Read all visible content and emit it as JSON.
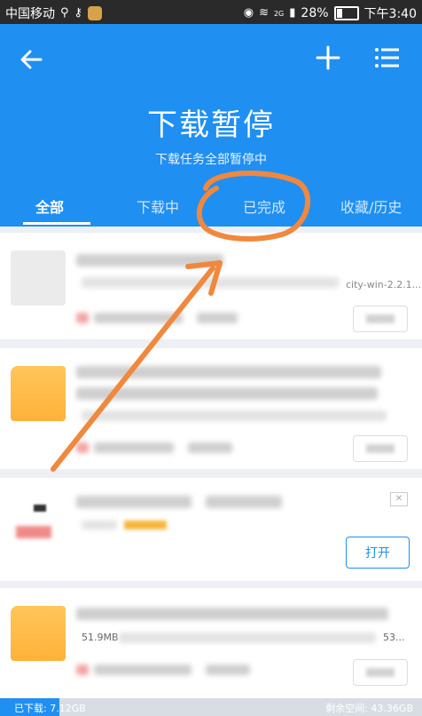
{
  "status_bar": {
    "carrier": "中国移动",
    "signal_badge": "2G",
    "battery_percent": "28%",
    "battery_level": 0.28,
    "time": "下午3:40"
  },
  "header": {
    "title": "下载暂停",
    "subtitle": "下载任务全部暂停中",
    "icons": {
      "back": "back-arrow-icon",
      "add": "plus-icon",
      "menu": "list-menu-icon"
    }
  },
  "tabs": [
    {
      "label": "全部",
      "active": true
    },
    {
      "label": "下载中",
      "active": false
    },
    {
      "label": "已完成",
      "active": false
    },
    {
      "label": "收藏/历史",
      "active": false
    }
  ],
  "list": {
    "item1": {
      "path_fragment": "city-win-2.2.1..."
    },
    "item3": {
      "open_button": "打开",
      "close_icon": "close-x-icon"
    },
    "item4": {
      "size": "51.9MB",
      "fragment": "53..."
    }
  },
  "storage": {
    "used_label": "已下载: 7.12GB",
    "free_label": "剩余空间: 43.36GB",
    "used_fraction": 0.14
  },
  "colors": {
    "accent": "#1f8ff2",
    "annotation": "#f0883e"
  }
}
